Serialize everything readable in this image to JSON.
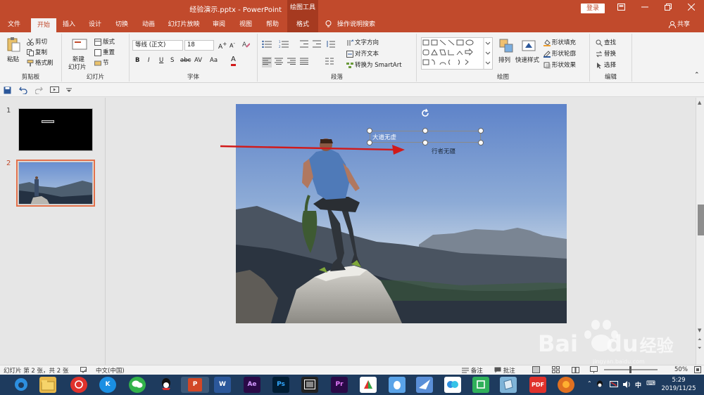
{
  "window": {
    "filename": "经验演示.pptx",
    "app": "PowerPoint",
    "title_sep": " - ",
    "context_tool": "绘图工具",
    "login_label": "登录"
  },
  "tabs": [
    {
      "label": "文件"
    },
    {
      "label": "开始"
    },
    {
      "label": "插入"
    },
    {
      "label": "设计"
    },
    {
      "label": "切换"
    },
    {
      "label": "动画"
    },
    {
      "label": "幻灯片放映"
    },
    {
      "label": "审阅"
    },
    {
      "label": "视图"
    },
    {
      "label": "帮助"
    },
    {
      "label": "格式"
    }
  ],
  "search_label": "操作说明搜索",
  "share_label": "共享",
  "ribbon": {
    "clipboard": {
      "paste": "粘贴",
      "cut": "剪切",
      "copy": "复制",
      "format_painter": "格式刷",
      "label": "剪贴板"
    },
    "slides": {
      "new_slide_1": "新建",
      "new_slide_2": "幻灯片",
      "layout": "版式",
      "reset": "重置",
      "section": "节",
      "label": "幻灯片"
    },
    "font": {
      "font_name": "等线 (正文)",
      "font_size": "18",
      "bold": "B",
      "italic": "I",
      "underline": "U",
      "shadow": "S",
      "strike": "abc",
      "spacing": "AV",
      "case": "Aa",
      "color": "A",
      "label": "字体"
    },
    "paragraph": {
      "text_direction": "文字方向",
      "align_text": "对齐文本",
      "smartart": "转换为 SmartArt",
      "label": "段落"
    },
    "drawing": {
      "arrange": "排列",
      "quick_styles": "快速样式",
      "shape_fill": "形状填充",
      "shape_outline": "形状轮廓",
      "shape_effects": "形状效果",
      "label": "绘图"
    },
    "editing": {
      "find": "查找",
      "replace": "替换",
      "select": "选择",
      "label": "编辑"
    }
  },
  "slides": [
    {
      "number": "1"
    },
    {
      "number": "2"
    }
  ],
  "slide": {
    "textbox_1": "大道无虚",
    "textbox_2": "行者无疆"
  },
  "status": {
    "slide_info": "幻灯片 第 2 张，共 2 张",
    "language": "中文(中国)",
    "notes": "备注",
    "comments": "批注",
    "zoom": "50%"
  },
  "taskbar": {
    "time": "5:29",
    "date": "2019/11/25",
    "apps": [
      "Ae",
      "Ps",
      "Pr",
      "PDF"
    ]
  },
  "watermark": {
    "text": "Bai",
    "text2": "du",
    "text3": "经验",
    "subtext": "jingyan.baidu.com"
  },
  "colors": {
    "accent": "#c14a2c",
    "selected_thumb": "#e2704a",
    "taskbar": "#1e3b5e",
    "arrow": "#d11a1a"
  }
}
